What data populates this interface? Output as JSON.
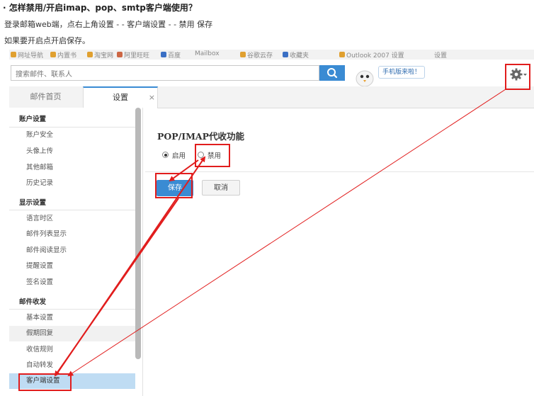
{
  "article": {
    "title": "· 怎样禁用/开启imap、pop、smtp客户端使用？",
    "step1": "登录邮箱web端，点右上角设置 - - 客户端设置 - - 禁用 保存",
    "step2": "如果要开启点开启保存。"
  },
  "browser": {
    "bookmarks": [
      "网址导航",
      "内置书",
      "淘宝网",
      "阿里旺旺",
      "百度",
      "Mailbox",
      "谷歌云存",
      "收藏夹",
      "Outlook 2007 设置",
      "设置"
    ]
  },
  "topbar": {
    "search_placeholder": "搜索邮件、联系人",
    "mobile_badge": "手机版来啦！"
  },
  "tabs": {
    "home": "邮件首页",
    "settings": "设置",
    "close": "×"
  },
  "sidebar": {
    "sections": [
      {
        "title": "账户设置",
        "items": [
          "账户安全",
          "头像上传",
          "其他邮箱",
          "历史记录"
        ]
      },
      {
        "title": "显示设置",
        "items": [
          "语言时区",
          "邮件列表显示",
          "邮件阅读显示",
          "提醒设置",
          "签名设置"
        ]
      },
      {
        "title": "邮件收发",
        "items": [
          "基本设置",
          "假期回复",
          "收信规则",
          "自动转发",
          "客户端设置"
        ]
      }
    ]
  },
  "main": {
    "title": "POP/IMAP代收功能",
    "option_enable": "启用",
    "option_disable": "禁用",
    "selected": "启用",
    "save_label": "保存",
    "cancel_label": "取消"
  },
  "colors": {
    "accent": "#3a8bd3",
    "annotation": "#e11d1d",
    "selected_row": "#bfdcf3"
  },
  "icons": [
    "search-icon",
    "mascot-icon",
    "gear-icon",
    "chevron-down-icon",
    "close-icon"
  ]
}
